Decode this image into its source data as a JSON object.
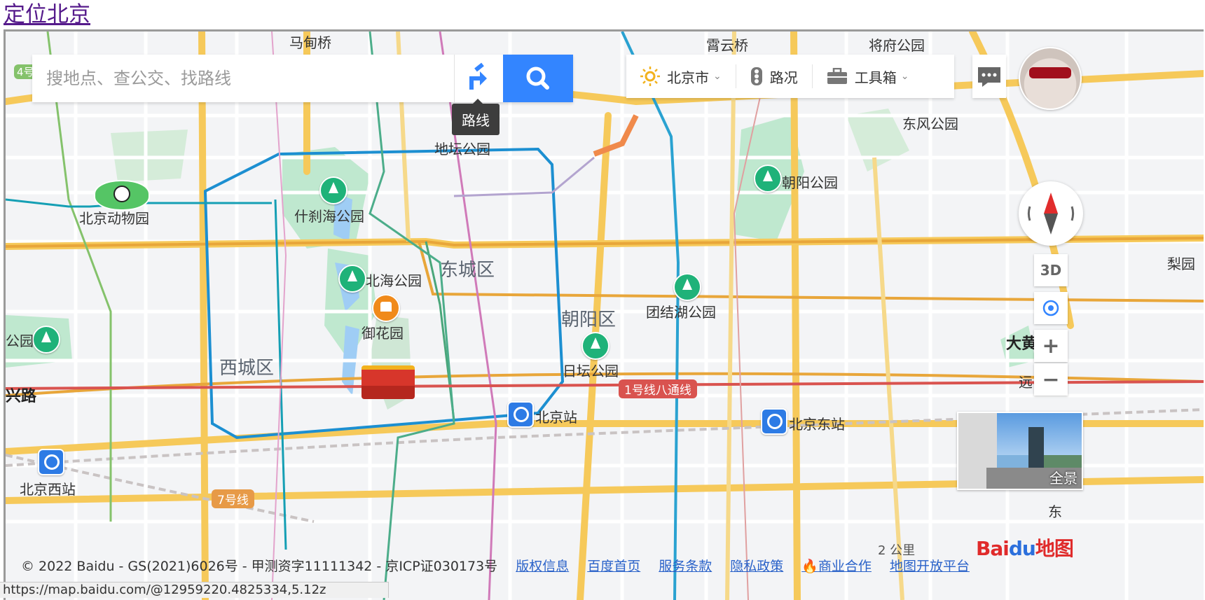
{
  "top_link": "定位北京",
  "search": {
    "placeholder": "搜地点、查公交、找路线",
    "route_tooltip": "路线"
  },
  "toolbar": {
    "city": "北京市",
    "traffic": "路况",
    "toolbox": "工具箱"
  },
  "map_labels": {
    "mdianqiao": "马甸桥",
    "xiayunqiao": "霄云桥",
    "jiangfu": "将府公园",
    "dongfeng": "东风公园",
    "ditan": "地坛公园",
    "chaoyang_park": "朝阳公园",
    "zoo": "北京动物园",
    "shichahai": "什刹海公园",
    "dongcheng": "东城区",
    "beihai": "北海公园",
    "yuhuayuan": "御花园",
    "chaoyang_dist": "朝阳区",
    "tuanjiehu": "团结湖公园",
    "xicheng": "西城区",
    "ritan": "日坛公园",
    "beijing_station": "北京站",
    "beijing_east": "北京东站",
    "beijing_west": "北京西站",
    "xingroad": "兴路",
    "yuan_left": "公园",
    "lizi_right": "梨园",
    "dahuang": "大黄",
    "yuan_edge": "远",
    "dong_edge": "东"
  },
  "line_badges": {
    "line1": "1号线八通线",
    "line7": "7号线",
    "line4": "4号"
  },
  "controls": {
    "three_d": "3D",
    "zoom_in": "+",
    "zoom_out": "−",
    "panorama": "全景"
  },
  "footer": {
    "copyright": "© 2022 Baidu - GS(2021)6026号 - 甲测资字11111342 - 京ICP证030173号",
    "links": [
      "版权信息",
      "百度首页",
      "服务条款",
      "隐私政策",
      "商业合作",
      "地图开放平台"
    ]
  },
  "scale_text": "2 公里",
  "logo": {
    "bai": "Bai",
    "du": "du",
    "map": "地图"
  },
  "status_url": "https://map.baidu.com/@12959220.4825334,5.12z",
  "colors": {
    "search_blue": "#3385ff",
    "park_green": "#1fb279",
    "line1_red": "#d9534f",
    "road_yellow": "#f6c95a"
  }
}
